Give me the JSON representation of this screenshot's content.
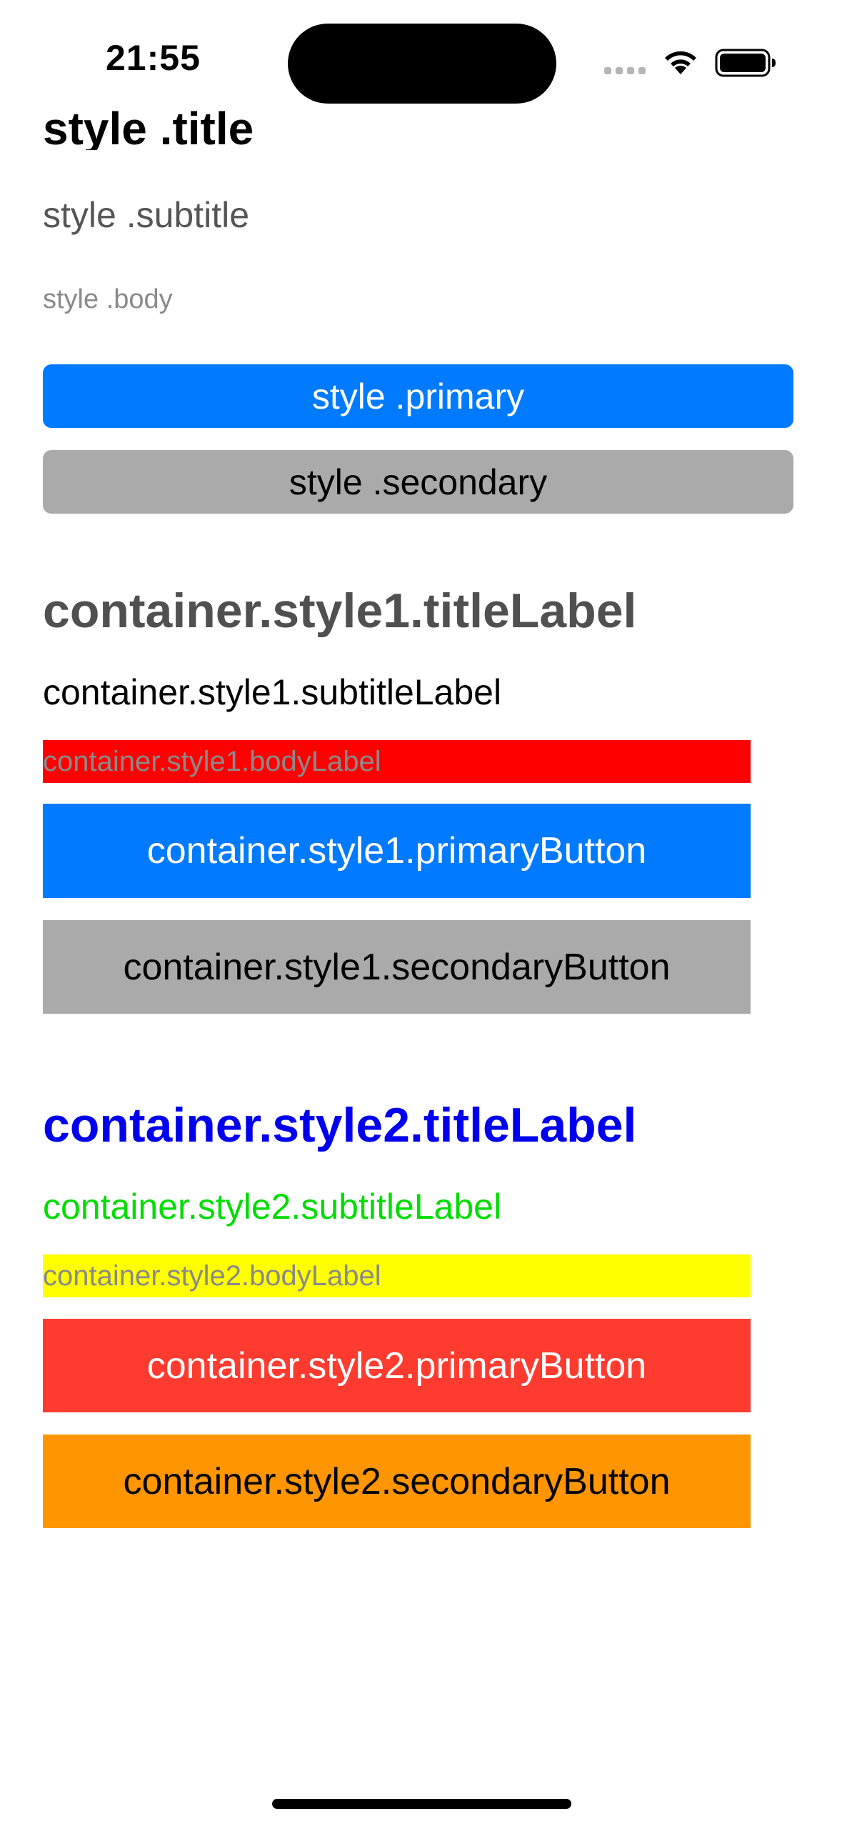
{
  "status_bar": {
    "time": "21:55"
  },
  "style": {
    "title": "style .title",
    "subtitle": "style .subtitle",
    "body": "style .body",
    "primary_button": "style .primary",
    "secondary_button": "style .secondary"
  },
  "container_style1": {
    "title_label": "container.style1.titleLabel",
    "subtitle_label": "container.style1.subtitleLabel",
    "body_label": "container.style1.bodyLabel",
    "primary_button": "container.style1.primaryButton",
    "secondary_button": "container.style1.secondaryButton"
  },
  "container_style2": {
    "title_label": "container.style2.titleLabel",
    "subtitle_label": "container.style2.subtitleLabel",
    "body_label": "container.style2.bodyLabel",
    "primary_button": "container.style2.primaryButton",
    "secondary_button": "container.style2.secondaryButton"
  },
  "colors": {
    "primary_blue": "#007aff",
    "secondary_gray": "#aaaaaa",
    "style1_body_bg": "#ff0000",
    "style2_title": "#0000ee",
    "style2_subtitle": "#00dd00",
    "style2_body_bg": "#ffff00",
    "style2_primary_bg": "#ff3b30",
    "style2_secondary_bg": "#ff9500"
  },
  "icons": [
    "cellular-signal-icon",
    "wifi-icon",
    "battery-icon"
  ]
}
